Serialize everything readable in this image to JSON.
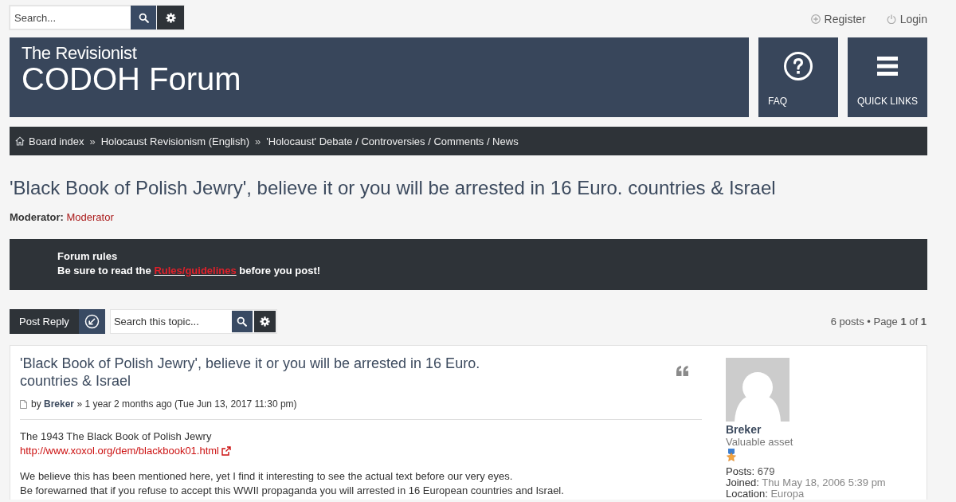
{
  "top_bar": {
    "search": {
      "placeholder": "Search..."
    },
    "user_links": [
      {
        "kind": "register",
        "label": "Register"
      },
      {
        "kind": "login",
        "label": "Login"
      }
    ]
  },
  "header": {
    "logo": {
      "line_1": "The Revisionist",
      "line_2": "CODOH Forum"
    },
    "tiles": [
      {
        "kind": "faq",
        "label": "FAQ"
      },
      {
        "kind": "quick_links",
        "label": "QUICK LINKS"
      }
    ]
  },
  "breadcrumbs": [
    {
      "kind": "home",
      "label": "Board index"
    },
    {
      "kind": "forum",
      "separator": "»",
      "label": "Holocaust Revisionism (English)"
    },
    {
      "kind": "forum",
      "separator": "»",
      "label": "'Holocaust' Debate / Controversies / Comments / News"
    }
  ],
  "topic": {
    "title": "'Black Book of Polish Jewry', believe it or you will be arrested in 16 Euro. countries & Israel",
    "moderator_label": "Moderator:",
    "moderator": "Moderator"
  },
  "forum_rules": {
    "title": "Forum rules",
    "text_before": "Be sure to read the",
    "link": "Rules/guidelines",
    "text_after": "before you post!"
  },
  "actions": {
    "post_reply": "Post Reply",
    "topic_search": {
      "placeholder": "Search this topic..."
    },
    "pagination": "6 posts • Page **1** of **1**"
  },
  "post": {
    "title": "'Black Book of Polish Jewry', believe it or you will be arrested in 16 Euro. countries & Israel",
    "meta": {
      "before": "by",
      "author": "Breker",
      "after": "» 1 year 2 months ago (Tue Jun 13, 2017 11:30 pm)"
    },
    "paragraphs": [
      [
        {
          "kind": "text",
          "text": "The 1943 The Black Book of Polish Jewry"
        },
        {
          "kind": "link",
          "text": "http://www.xoxol.org/dem/blackbook01.html"
        }
      ],
      [
        {
          "kind": "text",
          "text": "We believe this has been mentioned here, yet I find it interesting to see the actual text before our very eyes."
        },
        {
          "kind": "text",
          "text": "Be forewarned that if you refuse to accept this WWII propaganda you will arrested in 16 European countries and Israel."
        }
      ]
    ],
    "author": {
      "username": "Breker",
      "rank": "Valuable asset",
      "details": [
        {
          "label": "Posts:",
          "value": "679"
        },
        {
          "label": "Joined:",
          "value": "Thu May 18, 2006 5:39 pm"
        },
        {
          "label": "Location:",
          "value": "Europa"
        }
      ]
    }
  }
}
